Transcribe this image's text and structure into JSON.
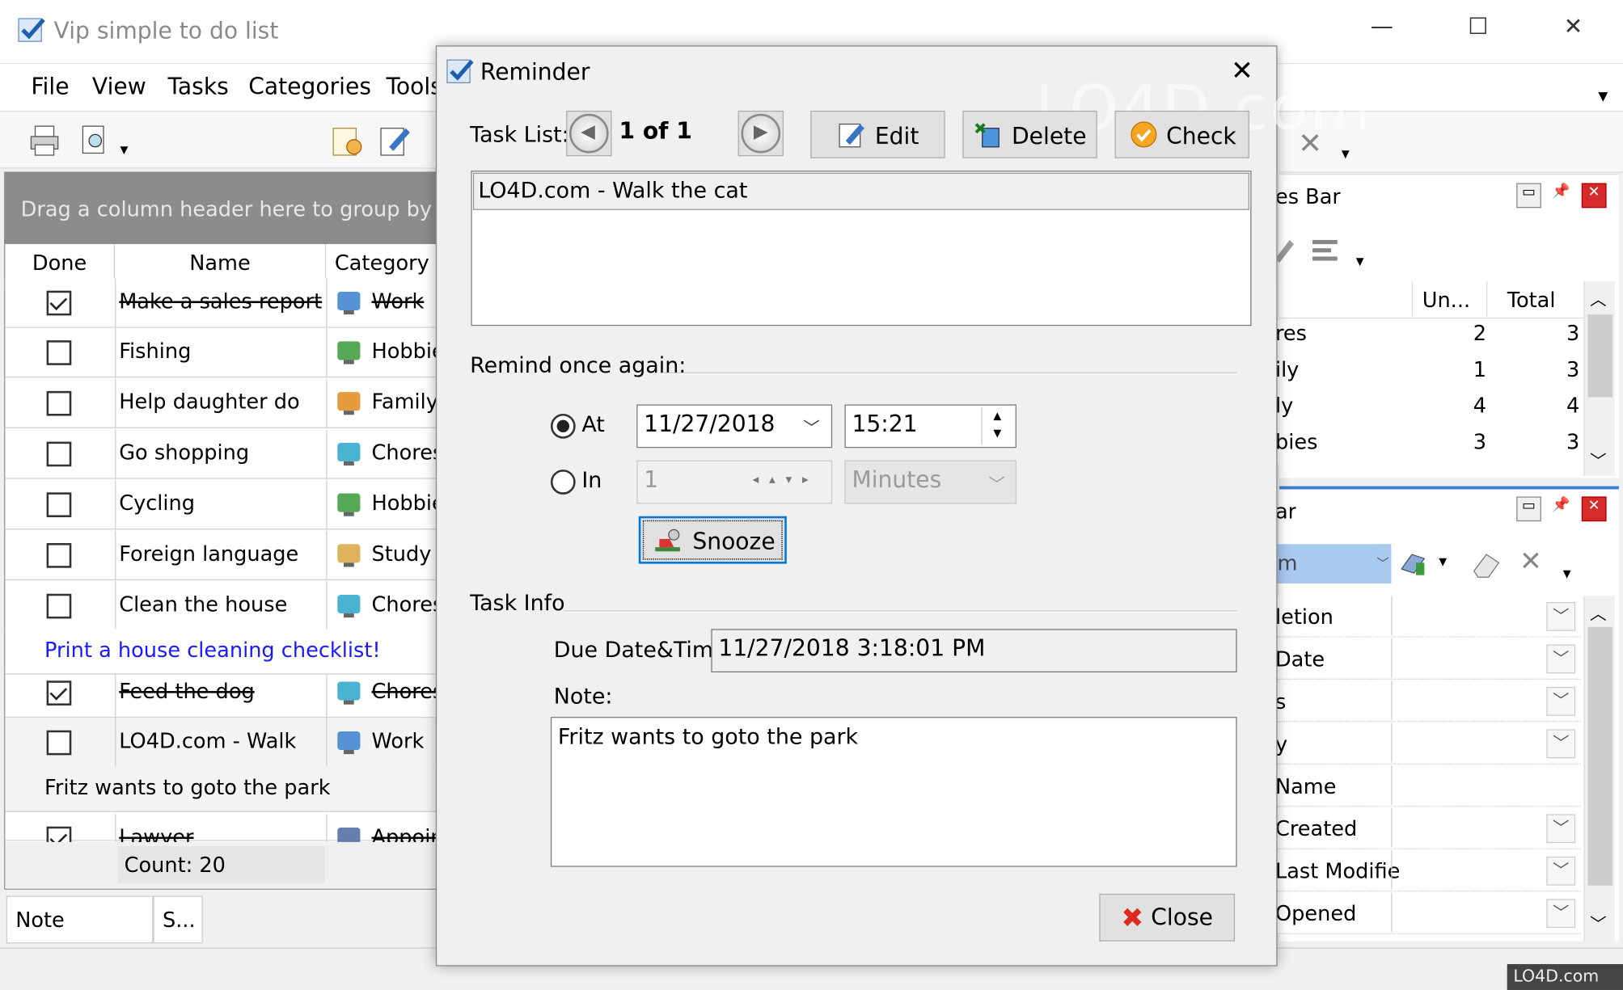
{
  "app": {
    "title": "Vip simple to do list",
    "window_controls": {
      "minimize": "—",
      "maximize": "☐",
      "close": "✕"
    }
  },
  "menu": [
    "File",
    "View",
    "Tasks",
    "Categories",
    "Tools"
  ],
  "grid": {
    "group_hint": "Drag a column header here to group by that",
    "columns": [
      "Done",
      "Name",
      "Category"
    ],
    "rows": [
      {
        "done": true,
        "name": "Make a sales report",
        "category": "Work",
        "icon": "monitor-icon",
        "strike": true
      },
      {
        "done": false,
        "name": "Fishing",
        "category": "Hobbies",
        "icon": "picture-icon",
        "strike": false
      },
      {
        "done": false,
        "name": "Help daughter do",
        "category": "Family",
        "icon": "people-icon",
        "strike": false
      },
      {
        "done": false,
        "name": "Go shopping",
        "category": "Chores",
        "icon": "recycle-icon",
        "strike": false
      },
      {
        "done": false,
        "name": "Cycling",
        "category": "Hobbies",
        "icon": "picture-icon",
        "strike": false
      },
      {
        "done": false,
        "name": "Foreign language",
        "category": "Study",
        "icon": "book-icon",
        "strike": false
      },
      {
        "done": false,
        "name": "Clean the house",
        "category": "Chores",
        "icon": "recycle-icon",
        "strike": false
      },
      {
        "done": true,
        "name": "Feed the dog",
        "category": "Chores",
        "icon": "recycle-icon",
        "strike": true
      },
      {
        "done": false,
        "name": "LO4D.com - Walk",
        "category": "Work",
        "icon": "monitor-icon",
        "strike": false
      },
      {
        "done": true,
        "name": "Lawyer",
        "category": "Appointment",
        "icon": "stopwatch-icon",
        "strike": true
      }
    ],
    "notes": {
      "clean_house": "Print a house cleaning checklist!",
      "walk": "Fritz wants to goto the park"
    },
    "count": "Count: 20",
    "link_color": "#1a1aff"
  },
  "bottom_tabs": [
    "Note",
    "S..."
  ],
  "categories_bar": {
    "title": "es Bar",
    "columns": [
      "Un...",
      "Total"
    ],
    "rows": [
      {
        "name": "res",
        "un": "2",
        "total": "3"
      },
      {
        "name": "ily",
        "un": "1",
        "total": "3"
      },
      {
        "name": "ly",
        "un": "4",
        "total": "4"
      },
      {
        "name": "bies",
        "un": "3",
        "total": "3"
      }
    ]
  },
  "properties_bar": {
    "title": "ar",
    "filter_value": "m",
    "fields": [
      "letion",
      "Date",
      "s",
      "y",
      "Name",
      "Created",
      "Last Modifie",
      "Opened"
    ]
  },
  "reminder": {
    "title": "Reminder",
    "task_list_label": "Task List:",
    "position": "1 of 1",
    "edit_label": "Edit",
    "delete_label": "Delete",
    "check_label": "Check",
    "task_text": "LO4D.com - Walk the cat",
    "remind_label": "Remind once again:",
    "at_label": "At",
    "date": "11/27/2018",
    "time": "15:21",
    "in_label": "In",
    "in_value": "1",
    "unit": "Minutes",
    "snooze_label": "Snooze",
    "task_info_label": "Task Info",
    "due_label": "Due Date&Time:",
    "due_value": "11/27/2018 3:18:01 PM",
    "note_label": "Note:",
    "note_text": "Fritz wants to goto the park",
    "close_label": "Close"
  },
  "watermark": "LO4D.com"
}
